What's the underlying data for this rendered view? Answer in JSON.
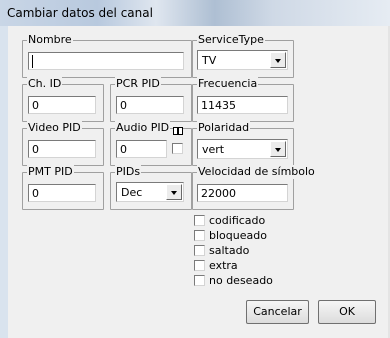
{
  "window": {
    "title": "Cambiar datos del canal"
  },
  "fields": {
    "nombre": {
      "label": "Nombre",
      "value": ""
    },
    "service_type": {
      "label": "ServiceType",
      "value": "TV"
    },
    "ch_id": {
      "label": "Ch. ID",
      "value": "0"
    },
    "pcr_pid": {
      "label": "PCR PID",
      "value": "0"
    },
    "frecuencia": {
      "label": "Frecuencia",
      "value": "11435"
    },
    "video_pid": {
      "label": "Video PID",
      "value": "0"
    },
    "audio_pid": {
      "label": "Audio PID",
      "value": "0"
    },
    "polaridad": {
      "label": "Polaridad",
      "value": "vert"
    },
    "pmt_pid": {
      "label": "PMT PID",
      "value": "0"
    },
    "pids": {
      "label": "PIDs",
      "value": "Dec"
    },
    "velocidad": {
      "label": "Velocidad de símbolo",
      "value": "22000"
    }
  },
  "checkboxes": [
    {
      "label": "codificado",
      "checked": false
    },
    {
      "label": "bloqueado",
      "checked": false
    },
    {
      "label": "saltado",
      "checked": false
    },
    {
      "label": "extra",
      "checked": false
    },
    {
      "label": "no deseado",
      "checked": false
    }
  ],
  "buttons": {
    "cancel": "Cancelar",
    "ok": "OK"
  }
}
